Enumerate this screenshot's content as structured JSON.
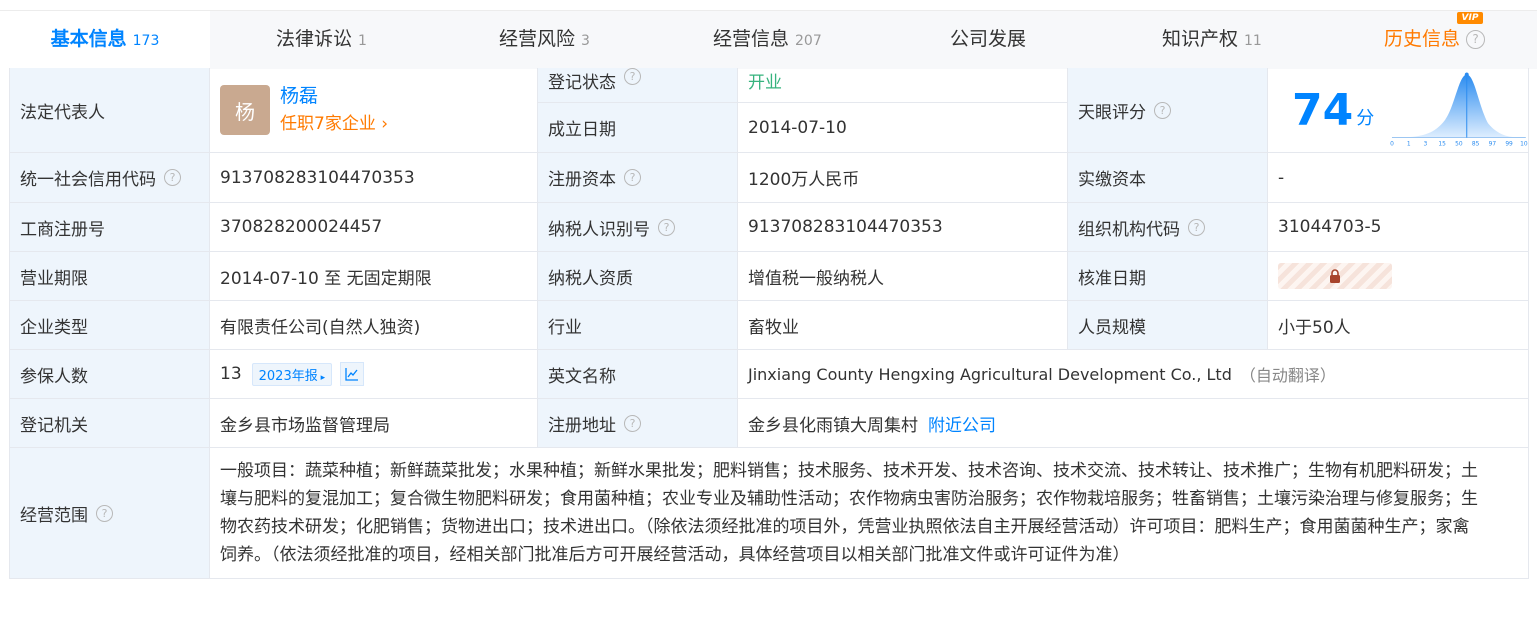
{
  "tabs": [
    {
      "label": "基本信息",
      "count": "173"
    },
    {
      "label": "法律诉讼",
      "count": "1"
    },
    {
      "label": "经营风险",
      "count": "3"
    },
    {
      "label": "经营信息",
      "count": "207"
    },
    {
      "label": "公司发展",
      "count": ""
    },
    {
      "label": "知识产权",
      "count": "11"
    },
    {
      "label": "历史信息",
      "count": "",
      "badge": "VIP"
    }
  ],
  "labels": {
    "legal_rep": "法定代表人",
    "reg_status": "登记状态",
    "found_date": "成立日期",
    "tianyan_score": "天眼评分",
    "credit_code": "统一社会信用代码",
    "reg_capital": "注册资本",
    "paid_capital": "实缴资本",
    "biz_reg_no": "工商注册号",
    "taxpayer_id": "纳税人识别号",
    "org_code": "组织机构代码",
    "biz_term": "营业期限",
    "taxpayer_qual": "纳税人资质",
    "approve_date": "核准日期",
    "company_type": "企业类型",
    "industry": "行业",
    "staff_size": "人员规模",
    "insured": "参保人数",
    "english_name": "英文名称",
    "reg_authority": "登记机关",
    "reg_address": "注册地址",
    "biz_scope": "经营范围"
  },
  "values": {
    "legal_rep_avatar": "杨",
    "legal_rep_name": "杨磊",
    "legal_rep_jobs": "任职7家企业",
    "reg_status": "开业",
    "found_date": "2014-07-10",
    "score": "74",
    "score_unit": "分",
    "credit_code": "913708283104470353",
    "reg_capital": "1200万人民币",
    "paid_capital": "-",
    "biz_reg_no": "370828200024457",
    "taxpayer_id": "913708283104470353",
    "org_code": "31044703-5",
    "biz_term": "2014-07-10 至 无固定期限",
    "taxpayer_qual": "增值税一般纳税人",
    "company_type": "有限责任公司(自然人独资)",
    "industry": "畜牧业",
    "staff_size": "小于50人",
    "insured": "13",
    "insured_report": "2023年报",
    "english_name": "Jinxiang County Hengxing Agricultural Development Co., Ltd",
    "auto_translate": "（自动翻译）",
    "reg_authority": "金乡县市场监督管理局",
    "reg_address": "金乡县化雨镇大周集村",
    "nearby": "附近公司",
    "biz_scope_lines": [
      "一般项目：蔬菜种植；新鲜蔬菜批发；水果种植；新鲜水果批发；肥料销售；技术服务、技术开发、技术咨询、技术交流、技术转让、技术推广；生物有机肥料研发；土",
      "壤与肥料的复混加工；复合微生物肥料研发；食用菌种植；农业专业及辅助性活动；农作物病虫害防治服务；农作物栽培服务；牲畜销售；土壤污染治理与修复服务；生",
      "物农药技术研发；化肥销售；货物进出口；技术进出口。（除依法须经批准的项目外，凭营业执照依法自主开展经营活动）许可项目：肥料生产；食用菌菌种生产；家禽",
      "饲养。（依法须经批准的项目，经相关部门批准后方可开展经营活动，具体经营项目以相关部门批准文件或许可证件为准）"
    ]
  },
  "score_chart": {
    "x_ticks": [
      "0",
      "1",
      "3",
      "15",
      "50",
      "85",
      "97",
      "99",
      "100"
    ],
    "marker": 74
  },
  "colors": {
    "accent": "#0084ff",
    "orange": "#ff7a00",
    "label_bg": "#eef5fc",
    "status_green": "#36b37e"
  }
}
